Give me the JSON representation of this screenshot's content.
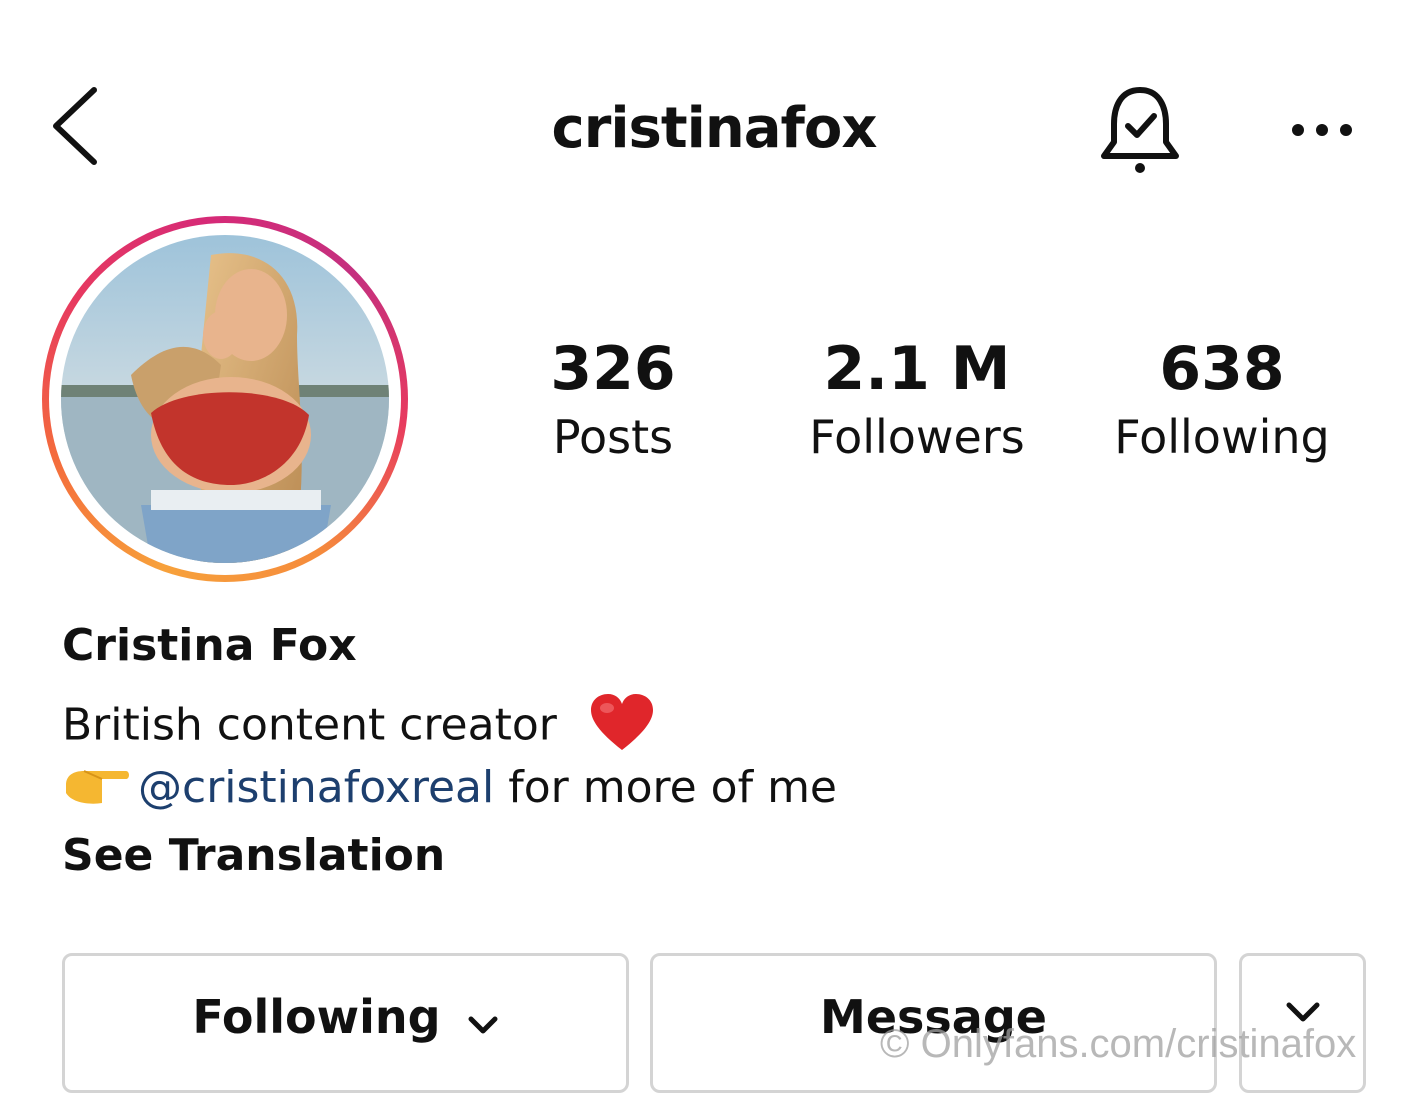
{
  "header": {
    "username": "cristinafox",
    "back_icon": "chevron-left-icon",
    "bell_icon": "bell-check-icon",
    "more_icon": "more-horizontal-icon"
  },
  "stats": [
    {
      "value": "326",
      "label": "Posts"
    },
    {
      "value": "2.1 M",
      "label": "Followers"
    },
    {
      "value": "638",
      "label": "Following"
    }
  ],
  "bio": {
    "full_name": "Cristina Fox",
    "line1": "British content creator",
    "line1_icon": "red-heart-emoji",
    "line2_icon": "pointing-right-emoji",
    "mention": "@cristinafoxreal",
    "line2_suffix": " for more of me",
    "see_translation": "See Translation"
  },
  "buttons": {
    "following": "Following",
    "message": "Message",
    "dropdown_icon": "chevron-down-icon"
  },
  "watermark": "© Onlyfans.com/cristinafox",
  "colors": {
    "mention": "#1d3f6e",
    "ring_start": "#f7a13b",
    "ring_end": "#d62a77",
    "button_border": "#d4d4d4"
  }
}
